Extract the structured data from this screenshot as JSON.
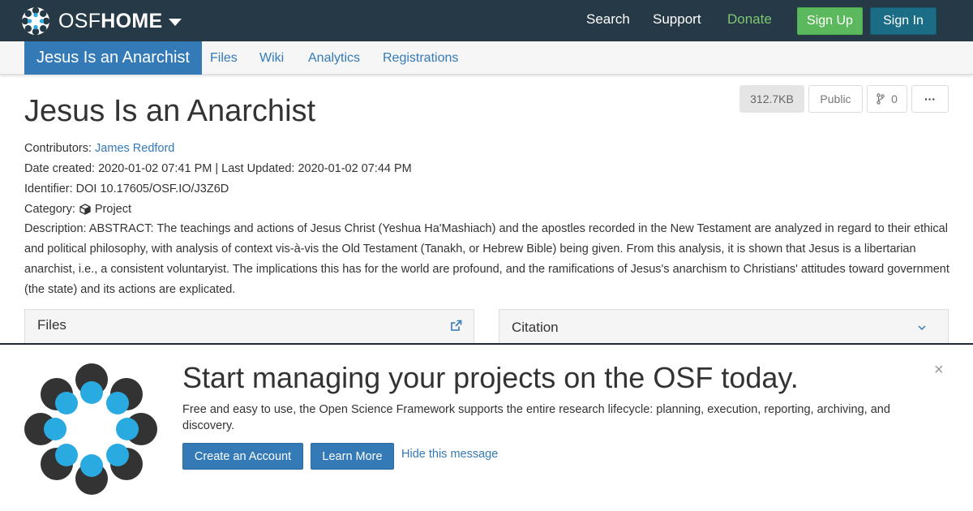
{
  "topnav": {
    "brand_light": "OSF",
    "brand_bold": "HOME",
    "links": {
      "search": "Search",
      "support": "Support",
      "donate": "Donate"
    },
    "signup": "Sign Up",
    "signin": "Sign In"
  },
  "subnav": {
    "title": "Jesus Is an Anarchist",
    "tabs": {
      "files": "Files",
      "wiki": "Wiki",
      "analytics": "Analytics",
      "registrations": "Registrations"
    }
  },
  "project": {
    "title": "Jesus Is an Anarchist",
    "size": "312.7KB",
    "visibility": "Public",
    "fork_count": "0",
    "more": "···",
    "contributors_label": "Contributors:",
    "contributor": "James Redford",
    "dates": "Date created: 2020-01-02 07:41 PM | Last Updated: 2020-01-02 07:44 PM",
    "identifier": "Identifier: DOI 10.17605/OSF.IO/J3Z6D",
    "category_label": "Category:",
    "category": "Project",
    "description": "Description: ABSTRACT: The teachings and actions of Jesus Christ (Yeshua Ha'Mashiach) and the apostles recorded in the New Testament are analyzed in regard to their ethical and political philosophy, with analysis of context vis-à-vis the Old Testament (Tanakh, or Hebrew Bible) being given. From this analysis, it is shown that Jesus is a libertarian anarchist, i.e., a consistent voluntaryist. The implications this has for the world are profound, and the ramifications of Jesus's anarchism to Christians' attitudes toward government (the state) and its actions are explicated."
  },
  "panels": {
    "files": "Files",
    "citation": "Citation"
  },
  "banner": {
    "heading": "Start managing your projects on the OSF today.",
    "text": "Free and easy to use, the Open Science Framework supports the entire research lifecycle: planning, execution, reporting, archiving, and discovery.",
    "create": "Create an Account",
    "learn": "Learn More",
    "hide": "Hide this message",
    "close": "×"
  },
  "colors": {
    "navbar": "#263947",
    "accent": "#337ab7",
    "signup": "#5cb85c",
    "signin": "#1b6d85",
    "donate": "#7fc771"
  }
}
